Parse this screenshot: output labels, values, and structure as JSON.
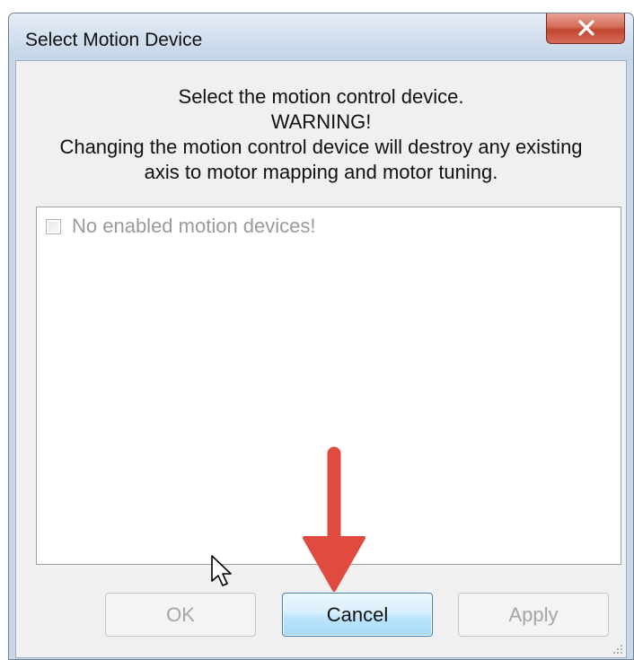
{
  "window": {
    "title": "Select Motion Device",
    "close_icon": "close-icon"
  },
  "message": {
    "line1": "Select the motion control device.",
    "line2": "WARNING!",
    "line3": "Changing the motion control device will destroy any existing",
    "line4": "axis to motor mapping and motor tuning."
  },
  "list": {
    "items": [
      {
        "label": "No enabled motion devices!",
        "checked": false,
        "enabled": false
      }
    ]
  },
  "buttons": {
    "ok": {
      "label": "OK",
      "enabled": false
    },
    "cancel": {
      "label": "Cancel",
      "enabled": true
    },
    "apply": {
      "label": "Apply",
      "enabled": false
    }
  },
  "annotations": {
    "arrow_color": "#e04a3f",
    "arrow_icon": "arrow-down-icon",
    "cursor_icon": "mouse-pointer-icon"
  }
}
